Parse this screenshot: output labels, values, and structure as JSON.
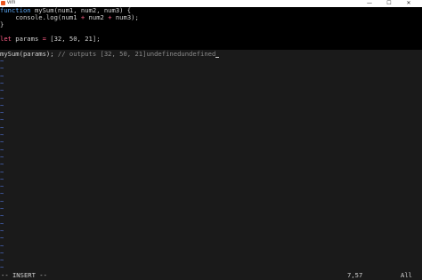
{
  "window": {
    "title": "vim",
    "minimize_glyph": "—",
    "maximize_glyph": "☐",
    "close_glyph": "✕",
    "icon": "terminal-icon"
  },
  "editor": {
    "line1": {
      "kw": "function",
      "name": "mySum",
      "params": "(num1, num2, num3) {"
    },
    "line2": {
      "indent": "    ",
      "call": "console.log(num1",
      "op1": "+",
      "mid": " num2 ",
      "op2": "+",
      "end": " num3);"
    },
    "line3": {
      "text": "}"
    },
    "line5": {
      "kw": "let",
      "rest": " params ",
      "op": "=",
      "val": " [32, 50, 21];"
    },
    "line7": {
      "code": "mySum(params);",
      "comment": " // outputs [32, 50, 21]undefinedundefined"
    },
    "tilde": "~"
  },
  "status": {
    "mode": "-- INSERT --",
    "position": "7,57",
    "scroll": "All"
  }
}
